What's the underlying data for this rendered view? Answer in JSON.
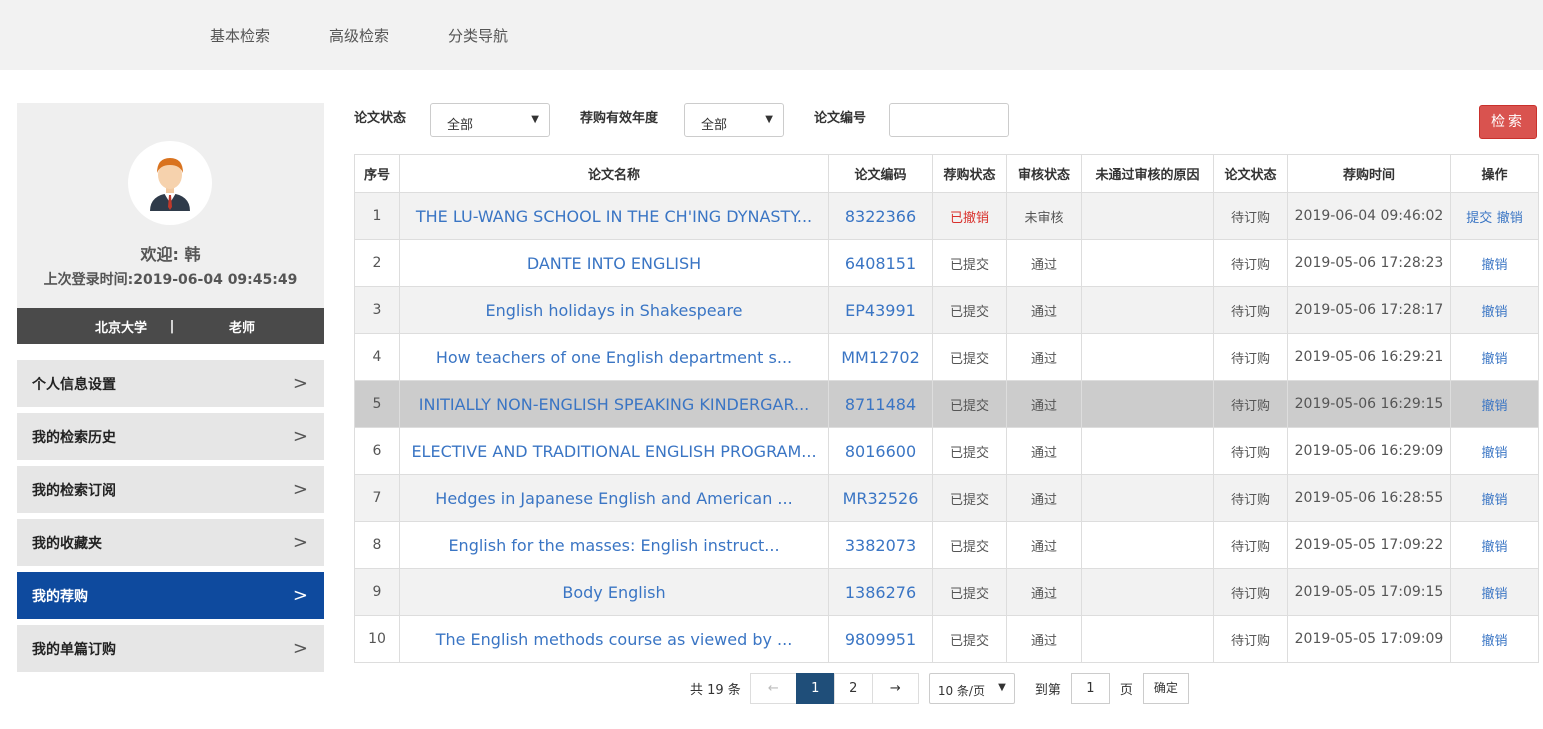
{
  "topnav": {
    "basic": "基本检索",
    "advanced": "高级检索",
    "category": "分类导航"
  },
  "profile": {
    "welcome_prefix": "欢迎:",
    "user": "韩",
    "last_login_label": "上次登录时间:",
    "last_login": "2019-06-04 09:45:49",
    "org": "北京大学",
    "separator": "|",
    "role": "老师"
  },
  "menu": [
    {
      "label": "个人信息设置",
      "active": false
    },
    {
      "label": "我的检索历史",
      "active": false
    },
    {
      "label": "我的检索订阅",
      "active": false
    },
    {
      "label": "我的收藏夹",
      "active": false
    },
    {
      "label": "我的荐购",
      "active": true
    },
    {
      "label": "我的单篇订购",
      "active": false
    }
  ],
  "filters": {
    "status_label": "论文状态",
    "status_value": "全部",
    "year_label": "荐购有效年度",
    "year_value": "全部",
    "code_label": "论文编号",
    "code_value": "",
    "search_button": "检索"
  },
  "table": {
    "headers": [
      "序号",
      "论文名称",
      "论文编码",
      "荐购状态",
      "审核状态",
      "未通过审核的原因",
      "论文状态",
      "荐购时间",
      "操作"
    ],
    "rows": [
      {
        "no": "1",
        "title": "THE LU-WANG SCHOOL IN THE CH'ING DYNASTY...",
        "code": "8322366",
        "rec_status": "已撤销",
        "audit": "未审核",
        "reason": "",
        "paper_status": "待订购",
        "time": "2019-06-04 09:46:02",
        "op1": "提交",
        "op2": "撤销"
      },
      {
        "no": "2",
        "title": "DANTE INTO ENGLISH",
        "code": "6408151",
        "rec_status": "已提交",
        "audit": "通过",
        "reason": "",
        "paper_status": "待订购",
        "time": "2019-05-06 17:28:23",
        "op1": "",
        "op2": "撤销"
      },
      {
        "no": "3",
        "title": "English holidays in Shakespeare",
        "code": "EP43991",
        "rec_status": "已提交",
        "audit": "通过",
        "reason": "",
        "paper_status": "待订购",
        "time": "2019-05-06 17:28:17",
        "op1": "",
        "op2": "撤销"
      },
      {
        "no": "4",
        "title": "How teachers of one English department s...",
        "code": "MM12702",
        "rec_status": "已提交",
        "audit": "通过",
        "reason": "",
        "paper_status": "待订购",
        "time": "2019-05-06 16:29:21",
        "op1": "",
        "op2": "撤销"
      },
      {
        "no": "5",
        "title": "INITIALLY NON-ENGLISH SPEAKING KINDERGAR...",
        "code": "8711484",
        "rec_status": "已提交",
        "audit": "通过",
        "reason": "",
        "paper_status": "待订购",
        "time": "2019-05-06 16:29:15",
        "op1": "",
        "op2": "撤销"
      },
      {
        "no": "6",
        "title": "ELECTIVE AND TRADITIONAL ENGLISH PROGRAM...",
        "code": "8016600",
        "rec_status": "已提交",
        "audit": "通过",
        "reason": "",
        "paper_status": "待订购",
        "time": "2019-05-06 16:29:09",
        "op1": "",
        "op2": "撤销"
      },
      {
        "no": "7",
        "title": "Hedges in Japanese English and American ...",
        "code": "MR32526",
        "rec_status": "已提交",
        "audit": "通过",
        "reason": "",
        "paper_status": "待订购",
        "time": "2019-05-06 16:28:55",
        "op1": "",
        "op2": "撤销"
      },
      {
        "no": "8",
        "title": "English for the masses: English instruct...",
        "code": "3382073",
        "rec_status": "已提交",
        "audit": "通过",
        "reason": "",
        "paper_status": "待订购",
        "time": "2019-05-05 17:09:22",
        "op1": "",
        "op2": "撤销"
      },
      {
        "no": "9",
        "title": "Body English",
        "code": "1386276",
        "rec_status": "已提交",
        "audit": "通过",
        "reason": "",
        "paper_status": "待订购",
        "time": "2019-05-05 17:09:15",
        "op1": "",
        "op2": "撤销"
      },
      {
        "no": "10",
        "title": "The English methods course as viewed by ...",
        "code": "9809951",
        "rec_status": "已提交",
        "audit": "通过",
        "reason": "",
        "paper_status": "待订购",
        "time": "2019-05-05 17:09:09",
        "op1": "",
        "op2": "撤销"
      }
    ]
  },
  "pager": {
    "total": "共 19 条",
    "prev": "←",
    "pages": [
      "1",
      "2"
    ],
    "current": "1",
    "next": "→",
    "page_size": "10 条/页",
    "goto_label": "到第",
    "goto_value": "1",
    "page_word": "页",
    "confirm": "确定"
  },
  "colors": {
    "accent": "#0e4a9e",
    "link": "#3a75c4",
    "danger": "#d9534f",
    "pager_active": "#1f4e79"
  },
  "icons": {
    "menu_arrow": "chevron-right-icon",
    "select_caret": "caret-down-icon",
    "avatar": "user-avatar-icon"
  }
}
